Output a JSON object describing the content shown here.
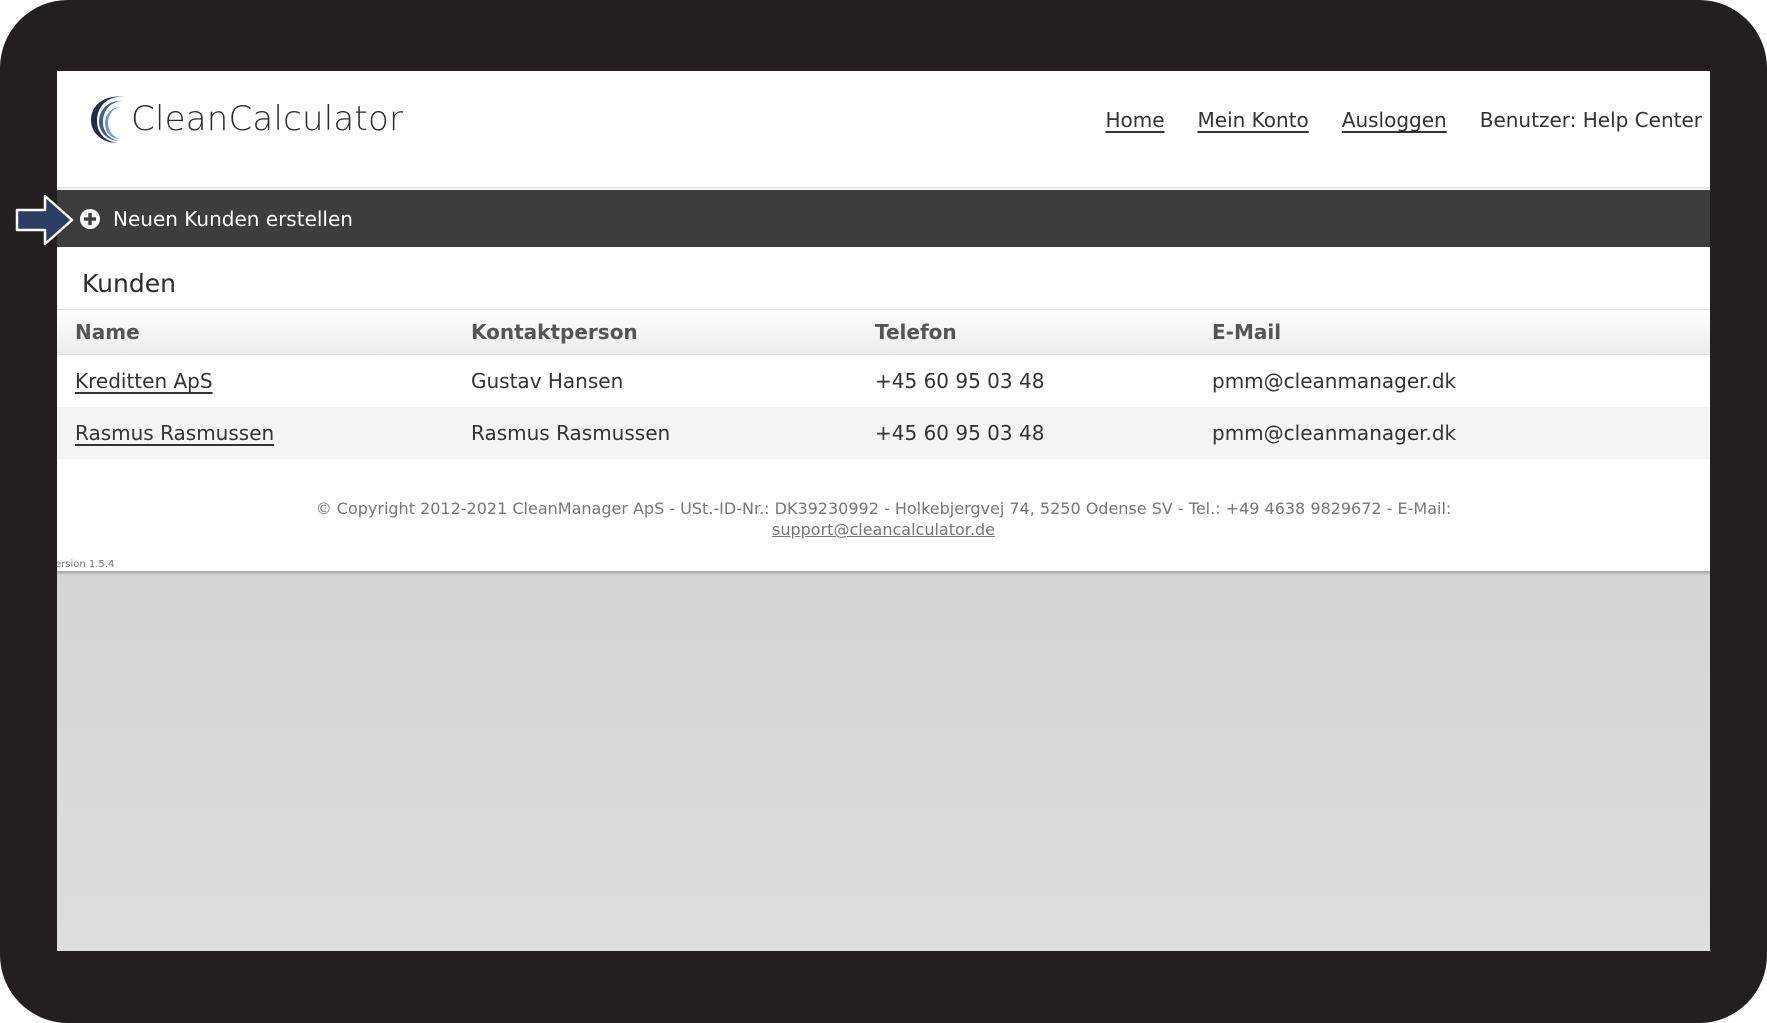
{
  "app": {
    "logo_text": "CleanCalculator"
  },
  "nav": {
    "items": [
      {
        "label": "Home"
      },
      {
        "label": "Mein Konto"
      },
      {
        "label": "Ausloggen"
      }
    ],
    "user_label": "Benutzer: Help Center"
  },
  "toolbar": {
    "create_label": "Neuen Kunden erstellen"
  },
  "section": {
    "title": "Kunden"
  },
  "table": {
    "headers": [
      "Name",
      "Kontaktperson",
      "Telefon",
      "E-Mail"
    ],
    "rows": [
      {
        "name": "Kreditten ApS",
        "contact": "Gustav Hansen",
        "phone": "+45 60 95 03 48",
        "email": "pmm@cleanmanager.dk"
      },
      {
        "name": "Rasmus Rasmussen",
        "contact": "Rasmus Rasmussen",
        "phone": "+45 60 95 03 48",
        "email": "pmm@cleanmanager.dk"
      }
    ]
  },
  "footer": {
    "copyright": "© Copyright 2012-2021 CleanManager ApS - USt.-ID-Nr.: DK39230992 - Holkebjergvej 74, 5250 Odense SV - Tel.: +49 4638 9829672 - E-Mail:",
    "email": "support@cleancalculator.de",
    "version": "ersion 1.5.4"
  },
  "colors": {
    "frame": "#231f20",
    "action_bar": "#3d3d3d",
    "logo_dark": "#1f2f4a",
    "logo_light": "#5f86c4",
    "arrow_fill": "#2c3e63"
  },
  "icons": {
    "logo": "crescent-logo-icon",
    "create": "plus-circle-icon",
    "guide": "arrow-right-icon"
  }
}
